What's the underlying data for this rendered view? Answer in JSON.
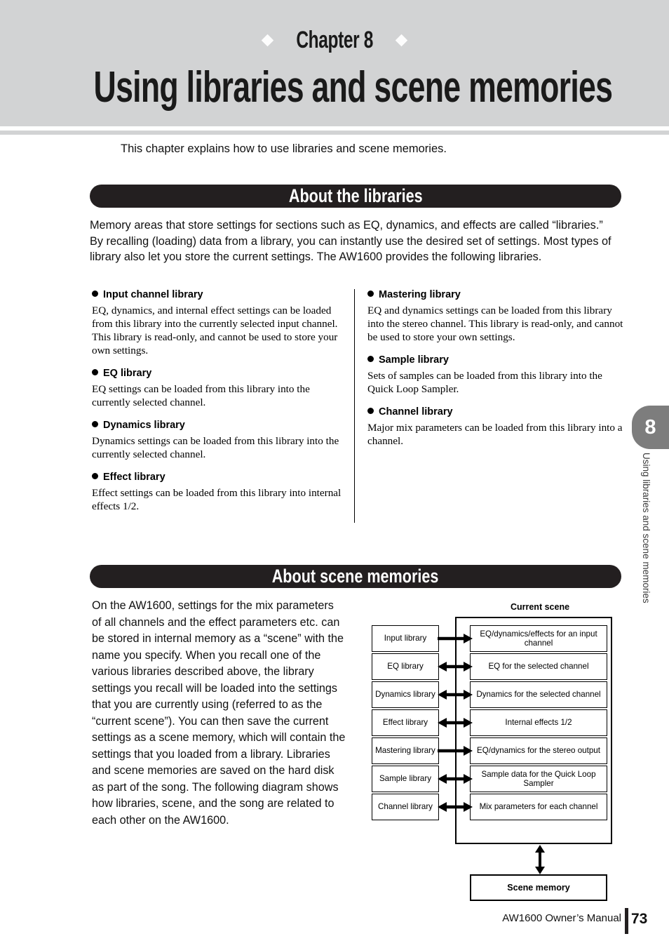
{
  "chapter": {
    "eyebrow": "Chapter 8",
    "title": "Using libraries and scene memories",
    "intro": "This chapter explains how to use libraries and scene memories."
  },
  "sections": {
    "libraries_bar": "About the libraries",
    "scene_bar": "About scene memories"
  },
  "libraries": {
    "intro": "Memory areas that store settings for sections such as EQ, dynamics, and effects are called “libraries.” By recalling (loading) data from a library, you can instantly use the desired set of settings. Most types of library also let you store the current settings. The AW1600 provides the following libraries.",
    "left": [
      {
        "head": "Input channel library",
        "body": "EQ, dynamics, and internal effect settings can be loaded from this library into the currently selected input channel. This library is read-only, and cannot be used to store your own settings."
      },
      {
        "head": "EQ library",
        "body": "EQ settings can be loaded from this library into the currently selected channel."
      },
      {
        "head": "Dynamics library",
        "body": "Dynamics settings can be loaded from this library into the currently selected channel."
      },
      {
        "head": "Effect library",
        "body": "Effect settings can be loaded from this library into internal effects 1/2."
      }
    ],
    "right": [
      {
        "head": "Mastering library",
        "body": "EQ and dynamics settings can be loaded from this library into the stereo channel. This library is read-only, and cannot be used to store your own settings."
      },
      {
        "head": "Sample library",
        "body": "Sets of samples can be loaded from this library into the Quick Loop Sampler."
      },
      {
        "head": "Channel library",
        "body": "Major mix parameters can be loaded from this library into a channel."
      }
    ]
  },
  "scene": {
    "text": "On the AW1600, settings for the mix parameters of all channels and the effect parameters etc. can be stored in internal memory as a “scene” with the name you specify.\nWhen you recall one of the various libraries described above, the library settings you recall will be loaded into the settings that you are currently using (referred to as the “current scene”). You can then save the current settings as a scene memory, which will contain the settings that you loaded from a library. Libraries and scene memories are saved on the hard disk as part of the song.\nThe following diagram shows how libraries, scene, and the song are related to each other on the AW1600."
  },
  "diagram": {
    "current_scene_label": "Current scene",
    "rows": [
      {
        "library": "Input library",
        "target": "EQ/dynamics/effects for an input channel",
        "arrow": "single-right"
      },
      {
        "library": "EQ library",
        "target": "EQ for the selected channel",
        "arrow": "double"
      },
      {
        "library": "Dynamics library",
        "target": "Dynamics for the selected channel",
        "arrow": "double"
      },
      {
        "library": "Effect library",
        "target": "Internal effects 1/2",
        "arrow": "double"
      },
      {
        "library": "Mastering library",
        "target": "EQ/dynamics for the stereo output",
        "arrow": "single-right"
      },
      {
        "library": "Sample library",
        "target": "Sample data for the Quick Loop Sampler",
        "arrow": "double"
      },
      {
        "library": "Channel library",
        "target": "Mix parameters for each channel",
        "arrow": "double"
      }
    ],
    "memory_box": "Scene memory"
  },
  "side_tab": {
    "number": "8",
    "label": "Using libraries and scene memories"
  },
  "footer": {
    "manual": "AW1600  Owner’s Manual",
    "page": "73"
  },
  "colors": {
    "banner_gray": "#d2d3d4",
    "bar_black": "#231f20",
    "tab_gray": "#7d7d7d"
  }
}
